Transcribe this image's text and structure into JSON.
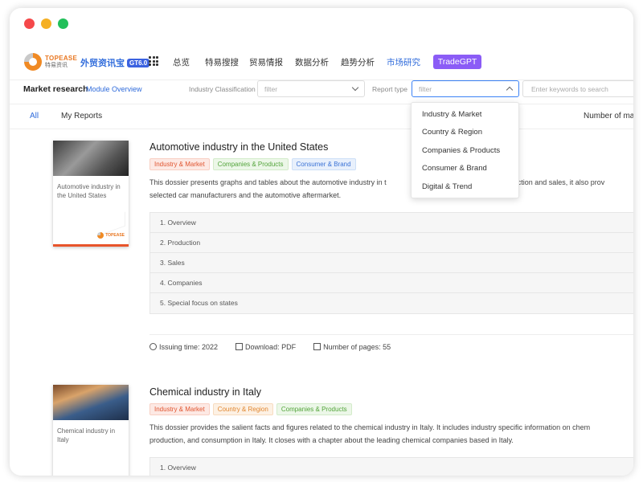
{
  "window": {
    "dot_colors": [
      "#f5484a",
      "#f5b024",
      "#22c05a"
    ]
  },
  "logo": {
    "en": "TOPEASE",
    "cn": "特易资讯"
  },
  "product": {
    "name": "外贸资讯宝",
    "badge": "GT6.0"
  },
  "nav": [
    "总览",
    "特易搜搜",
    "贸易情报",
    "数据分析",
    "趋势分析",
    "市场研究"
  ],
  "nav_active": "市场研究",
  "gpt_label": "TradeGPT",
  "filterbar": {
    "title": "Market research",
    "link": "Module Overview",
    "industry_label": "Industry Classification",
    "industry_placeholder": "filter",
    "report_label": "Report type",
    "report_placeholder": "filter",
    "keyword_placeholder": "Enter keywords to search"
  },
  "tabs": {
    "all": "All",
    "mine": "My Reports",
    "pages": "Number of ma"
  },
  "dropdown": [
    "Industry & Market",
    "Country & Region",
    "Companies & Products",
    "Consumer & Brand",
    "Digital & Trend"
  ],
  "reports": [
    {
      "cover_title": "Automotive industry in the United States",
      "title": "Automotive industry in the United States",
      "tags": [
        "Industry & Market",
        "Companies & Products",
        "Consumer & Brand"
      ],
      "desc1": "This dossier presents graphs and tables about the automotive industry in t",
      "desc1b": "production and sales, it also prov",
      "desc2": "selected car manufacturers and the automotive aftermarket.",
      "toc": [
        "1. Overview",
        "2. Production",
        "3. Sales",
        "4. Companies",
        "5. Special focus on states"
      ],
      "issuing": "Issuing time:  2022",
      "download": "Download:  PDF",
      "pages": "Number of pages:  55"
    },
    {
      "cover_title": "Chemical industry in Italy",
      "title": "Chemical industry in Italy",
      "tags": [
        "Industry & Market",
        "Country & Region",
        "Companies & Products"
      ],
      "desc1": "This dossier provides the salient facts and figures related to the chemical industry in Italy. It includes industry specific information on chem",
      "desc2": "production, and consumption in Italy. It closes with a chapter about the leading chemical companies based in Italy.",
      "toc": [
        "1. Overview"
      ]
    }
  ]
}
